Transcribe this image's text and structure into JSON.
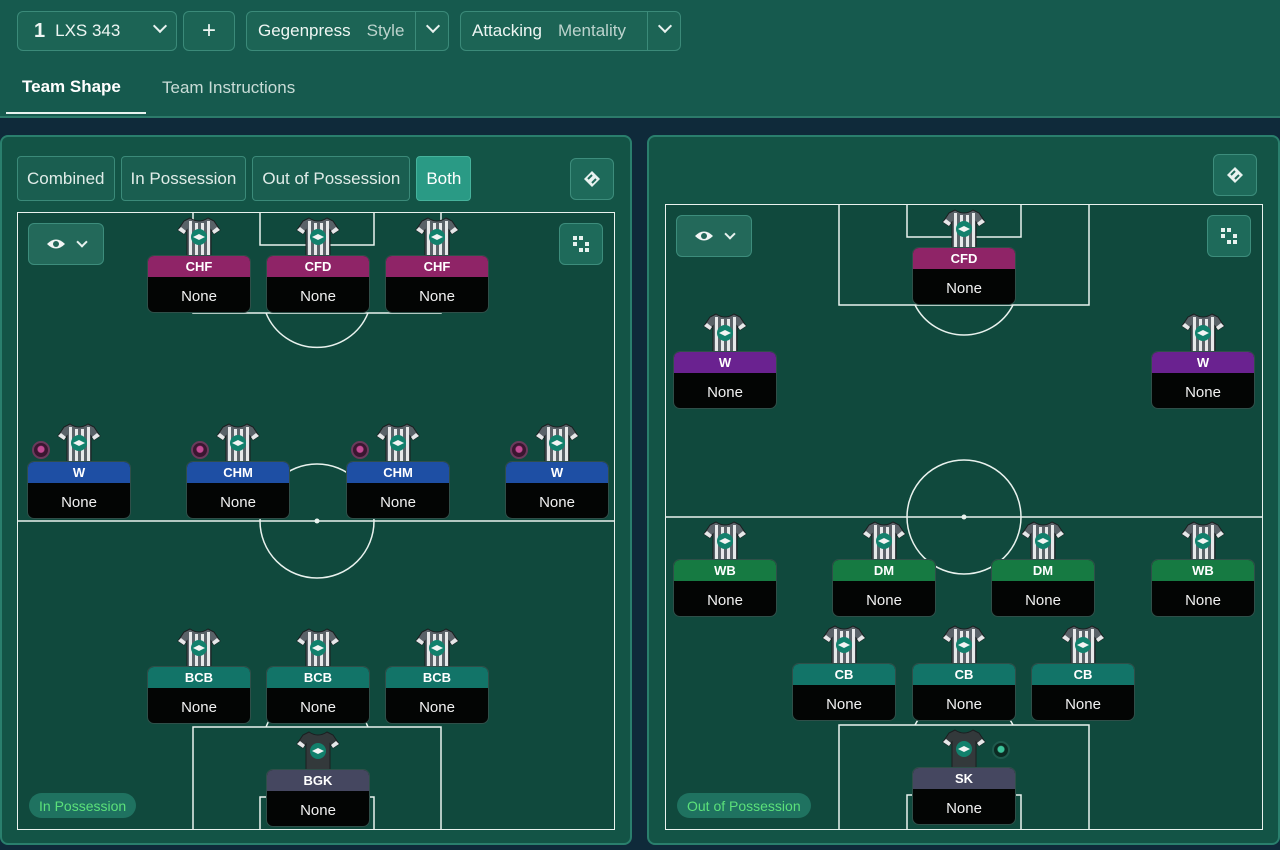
{
  "topbar": {
    "tactic_number": "1",
    "tactic_name": "LXS 343",
    "add_label": "+",
    "style": {
      "value": "Gegenpress",
      "label": "Style"
    },
    "mentality": {
      "value": "Attacking",
      "label": "Mentality"
    }
  },
  "tabs": [
    {
      "label": "Team Shape",
      "active": true
    },
    {
      "label": "Team Instructions",
      "active": false
    }
  ],
  "phase_toggle": {
    "options": [
      "Combined",
      "In Possession",
      "Out of Possession",
      "Both"
    ],
    "selected": "Both"
  },
  "left_pitch": {
    "phase_label": "In Possession",
    "players": [
      {
        "role": "CHF",
        "duty": "None",
        "color": "#8f2467"
      },
      {
        "role": "CFD",
        "duty": "None",
        "color": "#8f2467"
      },
      {
        "role": "CHF",
        "duty": "None",
        "color": "#8f2467"
      },
      {
        "role": "W",
        "duty": "None",
        "color": "#1e4fa4",
        "orb": true
      },
      {
        "role": "CHM",
        "duty": "None",
        "color": "#1e4fa4",
        "orb": true
      },
      {
        "role": "CHM",
        "duty": "None",
        "color": "#1e4fa4",
        "orb": true
      },
      {
        "role": "W",
        "duty": "None",
        "color": "#1e4fa4",
        "orb": true
      },
      {
        "role": "BCB",
        "duty": "None",
        "color": "#127468"
      },
      {
        "role": "BCB",
        "duty": "None",
        "color": "#127468"
      },
      {
        "role": "BCB",
        "duty": "None",
        "color": "#127468"
      },
      {
        "role": "BGK",
        "duty": "None",
        "color": "#454760",
        "gk": true
      }
    ]
  },
  "right_pitch": {
    "phase_label": "Out of Possession",
    "players": [
      {
        "role": "CFD",
        "duty": "None",
        "color": "#8f2467"
      },
      {
        "role": "W",
        "duty": "None",
        "color": "#6a2290"
      },
      {
        "role": "W",
        "duty": "None",
        "color": "#6a2290"
      },
      {
        "role": "WB",
        "duty": "None",
        "color": "#167a42"
      },
      {
        "role": "DM",
        "duty": "None",
        "color": "#167a42"
      },
      {
        "role": "DM",
        "duty": "None",
        "color": "#167a42"
      },
      {
        "role": "WB",
        "duty": "None",
        "color": "#167a42"
      },
      {
        "role": "CB",
        "duty": "None",
        "color": "#127468"
      },
      {
        "role": "CB",
        "duty": "None",
        "color": "#127468"
      },
      {
        "role": "CB",
        "duty": "None",
        "color": "#127468"
      },
      {
        "role": "SK",
        "duty": "None",
        "color": "#454760",
        "gk": true,
        "orb_green": true
      }
    ]
  },
  "icons": {
    "dropdown": "chevron-down-icon",
    "view": "eye-icon",
    "grid": "grid-icon",
    "pitch_toggle": "pitch-icon",
    "orb": "instruction-orb-icon"
  }
}
